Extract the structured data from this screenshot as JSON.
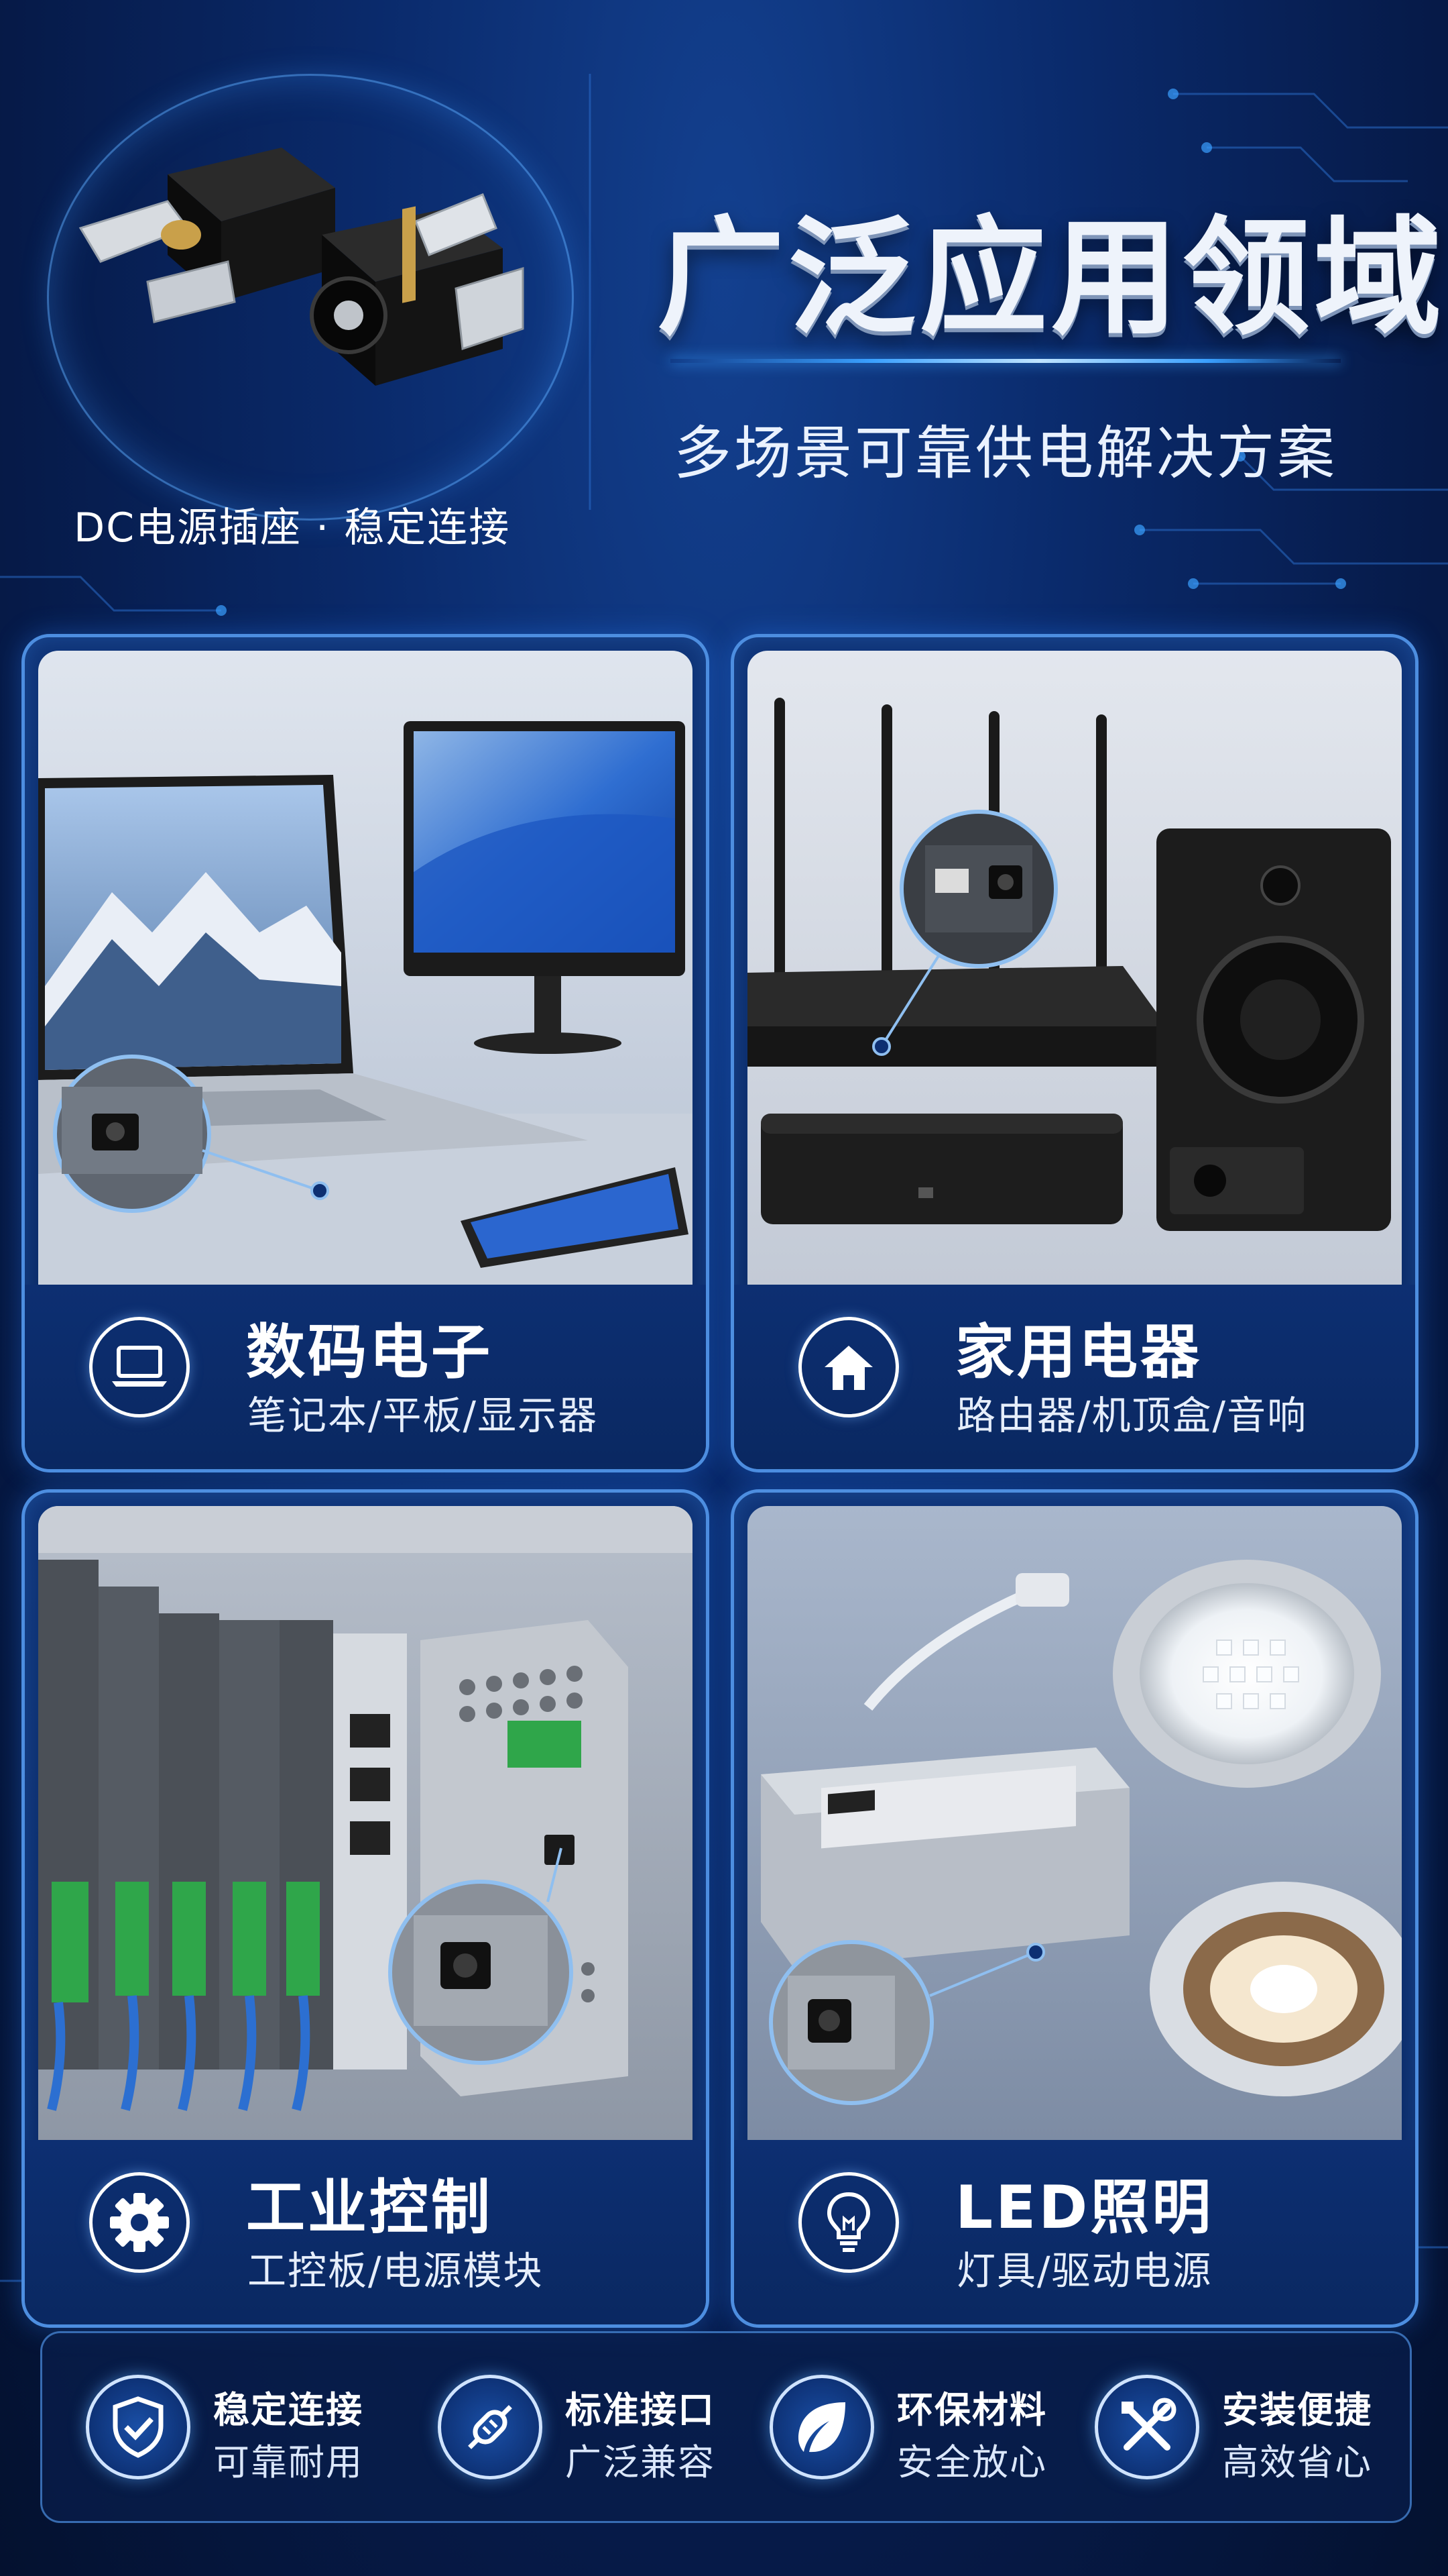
{
  "header": {
    "title": "广泛应用领域",
    "subtitle": "多场景可靠供电解决方案",
    "hero_caption": "DC电源插座 · 稳定连接"
  },
  "cards": [
    {
      "title": "数码电子",
      "subtitle": "笔记本/平板/显示器",
      "icon": "laptop-icon"
    },
    {
      "title": "家用电器",
      "subtitle": "路由器/机顶盒/音响",
      "icon": "home-icon"
    },
    {
      "title": "工业控制",
      "subtitle": "工控板/电源模块",
      "icon": "gear-icon"
    },
    {
      "title": "LED照明",
      "subtitle": "灯具/驱动电源",
      "icon": "lightbulb-icon"
    }
  ],
  "features": [
    {
      "line1": "稳定连接",
      "line2": "可靠耐用",
      "icon": "shield-check-icon"
    },
    {
      "line1": "标准接口",
      "line2": "广泛兼容",
      "icon": "connector-icon"
    },
    {
      "line1": "环保材料",
      "line2": "安全放心",
      "icon": "leaf-icon"
    },
    {
      "line1": "安装便捷",
      "line2": "高效省心",
      "icon": "tools-icon"
    }
  ],
  "colors": {
    "background": "#061b4a",
    "accent": "#3aa0ff",
    "card_border": "#4d8ee0",
    "text": "#ffffff"
  }
}
